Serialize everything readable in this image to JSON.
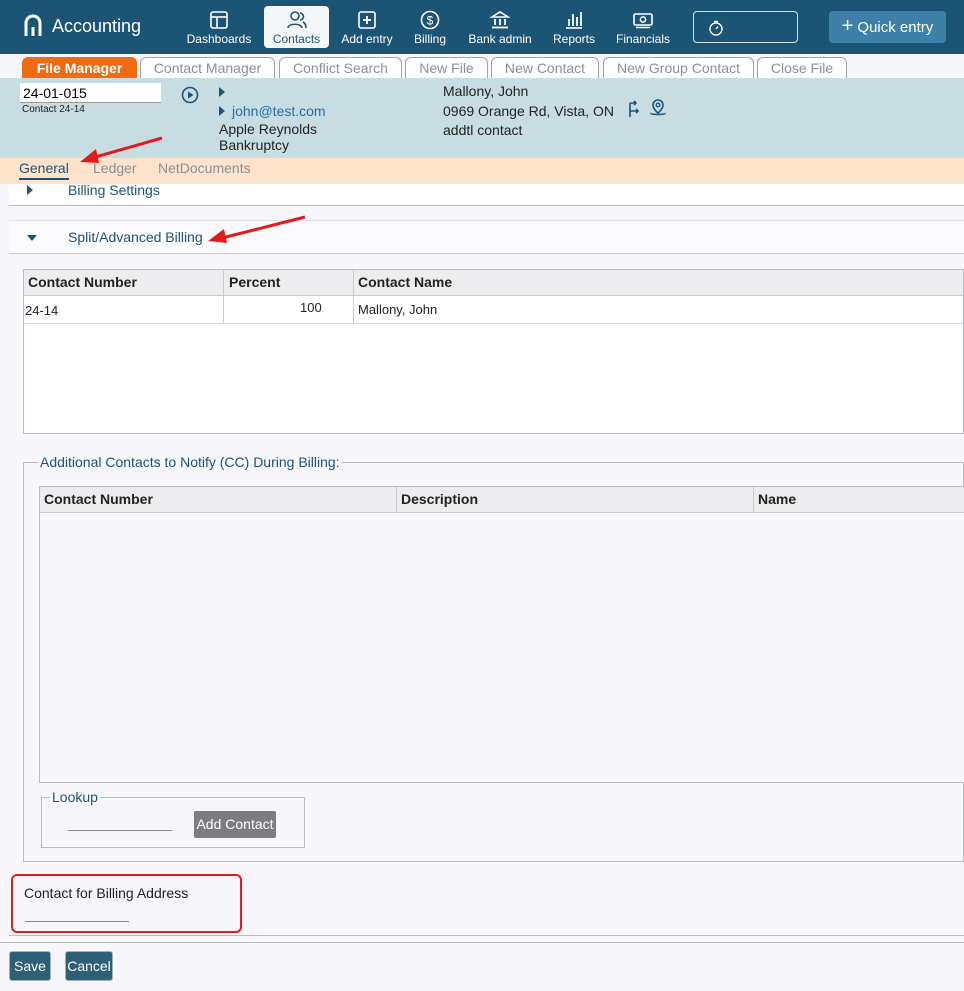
{
  "app": {
    "brand_name": "Accounting",
    "nav": [
      {
        "label": "Dashboards",
        "icon": "dashboard-icon"
      },
      {
        "label": "Contacts",
        "icon": "contacts-icon",
        "active": true
      },
      {
        "label": "Add entry",
        "icon": "add-entry-icon"
      },
      {
        "label": "Billing",
        "icon": "dollar-icon"
      },
      {
        "label": "Bank admin",
        "icon": "bank-icon"
      },
      {
        "label": "Reports",
        "icon": "bar-chart-icon"
      },
      {
        "label": "Financials",
        "icon": "money-icon"
      }
    ],
    "timer_icon": "stopwatch-icon",
    "quick_entry_label": "Quick entry",
    "colors": {
      "nav_bg": "#1c5475",
      "active_tab": "#f26a0f",
      "highlight": "#e21b1b"
    }
  },
  "tabs": [
    "File Manager",
    "Contact Manager",
    "Conflict Search",
    "New File",
    "New Contact",
    "New Group Contact",
    "Close File"
  ],
  "file": {
    "number": "24-01-015",
    "contact_ref": "Contact 24-14",
    "email": "john@test.com",
    "client_name": "Apple Reynolds",
    "matter_type": "Bankruptcy",
    "contact_name": "Mallony, John",
    "address": "0969 Orange Rd, Vista, ON",
    "note": "addtl contact"
  },
  "subtabs": [
    "General",
    "Ledger",
    "NetDocuments"
  ],
  "panels": {
    "billing_settings_title": "Billing Settings",
    "split_title": "Split/Advanced Billing"
  },
  "split_grid": {
    "headers": [
      "Contact Number",
      "Percent",
      "Contact Name"
    ],
    "rows": [
      {
        "contact_number": "24-14",
        "percent": "100",
        "contact_name": "Mallony, John"
      }
    ]
  },
  "cc": {
    "legend": "Additional Contacts to Notify (CC) During Billing:",
    "headers": [
      "Contact Number",
      "Description",
      "Name"
    ],
    "lookup_legend": "Lookup",
    "add_contact_label": "Add Contact"
  },
  "billing_address": {
    "label": "Contact for Billing Address"
  },
  "footer": {
    "save_label": "Save",
    "cancel_label": "Cancel"
  }
}
